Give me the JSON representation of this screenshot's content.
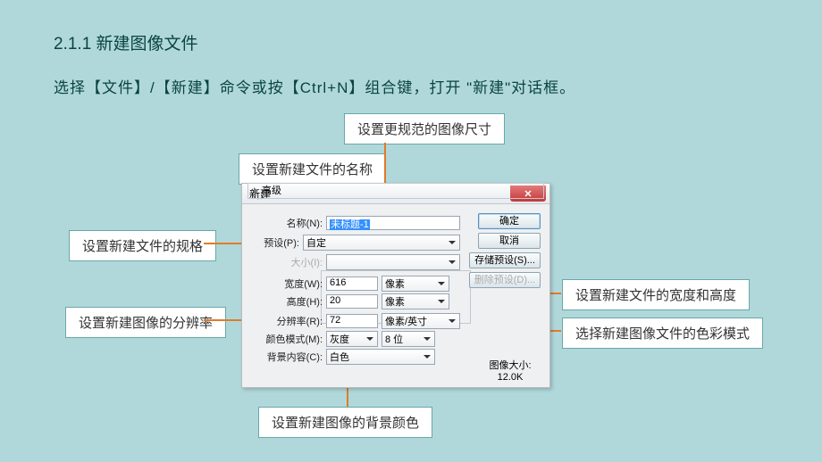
{
  "slide": {
    "heading": "2.1.1  新建图像文件",
    "subtext": "选择【文件】/【新建】命令或按【Ctrl+N】组合键，打开 \"新建\"对话框。"
  },
  "callouts": {
    "c1": "设置更规范的图像尺寸",
    "c2": "设置新建文件的名称",
    "c3": "设置新建文件的规格",
    "c4": "设置新建文件的宽度和高度",
    "c5": "设置新建图像的分辨率",
    "c6": "选择新建图像文件的色彩模式",
    "c7": "设置新建图像的背景颜色"
  },
  "dialog": {
    "title": "新建",
    "labels": {
      "name": "名称(N):",
      "preset": "预设(P):",
      "size": "大小(I):",
      "width": "宽度(W):",
      "height": "高度(H):",
      "resolution": "分辨率(R):",
      "color_mode": "颜色模式(M):",
      "bg": "背景内容(C):",
      "advanced": "高级",
      "file_size_label": "图像大小:"
    },
    "values": {
      "name": "未标题-1",
      "preset": "自定",
      "size": "",
      "width": "616",
      "height": "20",
      "width_unit": "像素",
      "height_unit": "像素",
      "resolution": "72",
      "resolution_unit": "像素/英寸",
      "color_mode": "灰度",
      "bit_depth": "8 位",
      "bg": "白色",
      "file_size": "12.0K"
    },
    "buttons": {
      "ok": "确定",
      "cancel": "取消",
      "save_preset": "存储预设(S)...",
      "delete_preset": "删除预设(D)..."
    }
  }
}
